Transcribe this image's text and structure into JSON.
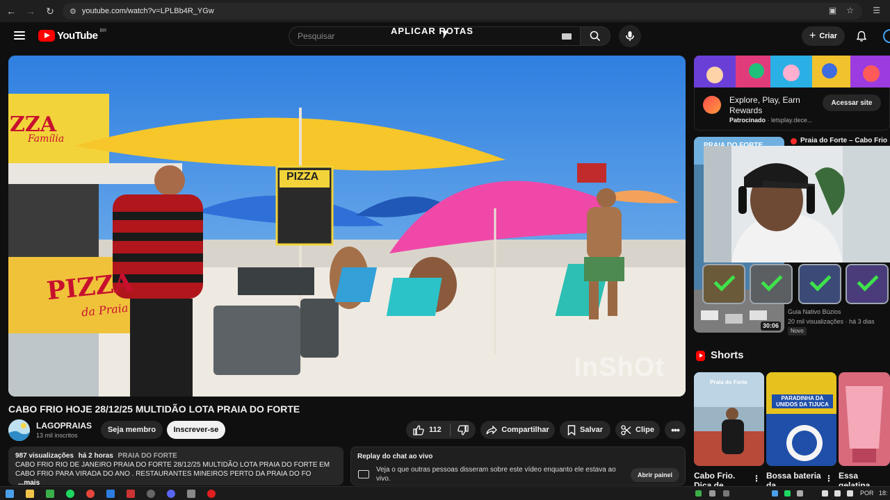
{
  "browser": {
    "url": "youtube.com/watch?v=LPLBb4R_YGw",
    "icons": [
      "back-icon",
      "forward-icon",
      "reload-icon",
      "site-info-icon",
      "cast-icon",
      "star-icon",
      "reading-list-icon"
    ]
  },
  "header": {
    "logo_text": "YouTube",
    "region": "BR",
    "search_placeholder": "Pesquisar",
    "overlay_text": "APLICAR ROTAS",
    "create_label": "Criar"
  },
  "video": {
    "title": "CABO FRIO HOJE 28/12/25 MULTIDÃO LOTA PRAIA DO FORTE",
    "watermark": "InShOt",
    "signs": {
      "pizza_top": "ZZA",
      "pizza_top_sub": "Família",
      "pizza_board": "PIZZA",
      "pizza_side": "PIZZA",
      "pizza_side_sub": "da Praia"
    }
  },
  "channel": {
    "name": "LAGOPRAIAS",
    "subscribers": "13 mil inscritos",
    "member_label": "Seja membro",
    "subscribe_label": "Inscrever-se"
  },
  "actions": {
    "likes": "112",
    "share_label": "Compartilhar",
    "save_label": "Salvar",
    "clip_label": "Clipe"
  },
  "description": {
    "views": "987 visualizações",
    "time": "há 2 horas",
    "tag": "PRAIA DO FORTE",
    "text": "CABO FRIO RIO DE JANEIRO PRAIA DO FORTE 28/12/25 MULTIDÃO LOTA PRAIA DO FORTE EM CABO FRIO PARA VIRADA DO ANO . RESTAURANTES MINEIROS PERTO DA PRAIA DO FO",
    "more": "...mais"
  },
  "chat_replay": {
    "title": "Replay do chat ao vivo",
    "text": "Veja o que outras pessoas disseram sobre este vídeo enquanto ele estava ao vivo.",
    "button": "Abrir painel"
  },
  "ad": {
    "title": "Explore, Play, Earn Rewards",
    "sponsored": "Patrocinado",
    "domain": "letsplay.dece...",
    "button": "Acessar site"
  },
  "recommendation": {
    "title": "Praia do Forte – Cabo Frio",
    "thumb_label": "PRAIA DO FORTE",
    "channel": "Guia Nativo Búzios",
    "views": "20 mil visualizações",
    "time": "há 3 dias",
    "badge": "Novo",
    "duration": "30:06"
  },
  "shorts": {
    "title": "Shorts",
    "items": [
      {
        "title": "Cabo Frio. Dica de",
        "overlay": "Praia do Forte"
      },
      {
        "title": "Bossa bateria da",
        "overlay": "PARADINHA DA UNIDOS DA TIJUCA"
      },
      {
        "title": "Essa gelatina",
        "overlay": ""
      }
    ]
  },
  "taskbar": {
    "language": "POR",
    "time": "18:"
  },
  "colors": {
    "background": "#0f0f0f",
    "accent_red": "#ff0000",
    "pill": "#272727"
  }
}
